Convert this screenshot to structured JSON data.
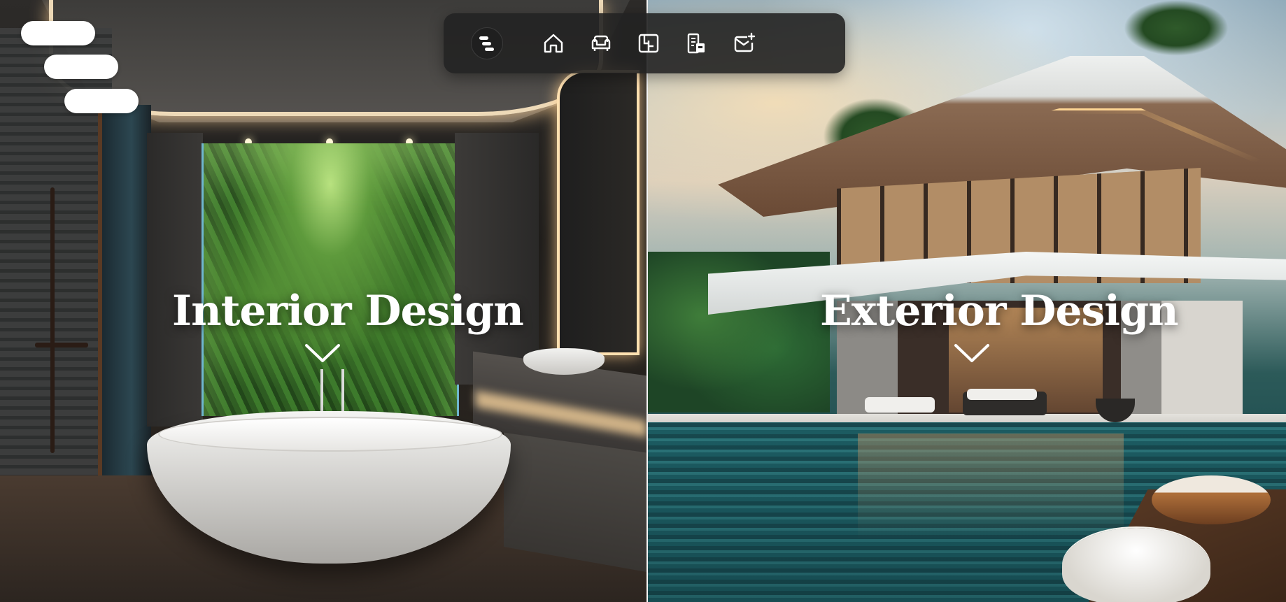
{
  "menu": {
    "icon": "hamburger-menu-icon"
  },
  "navbar": {
    "logo_icon": "brand-logo-icon",
    "items": [
      {
        "icon": "home-icon"
      },
      {
        "icon": "sofa-icon"
      },
      {
        "icon": "floor-plan-icon"
      },
      {
        "icon": "building-icon"
      },
      {
        "icon": "mail-add-icon"
      }
    ]
  },
  "panels": {
    "interior": {
      "title": "Interior Design",
      "chevron_icon": "chevron-down-icon"
    },
    "exterior": {
      "title": "Exterior Design",
      "chevron_icon": "chevron-down-icon"
    }
  },
  "colors": {
    "navbar_bg": "#222222",
    "heading_text": "#ffffff",
    "icon_stroke": "#ffffff"
  }
}
